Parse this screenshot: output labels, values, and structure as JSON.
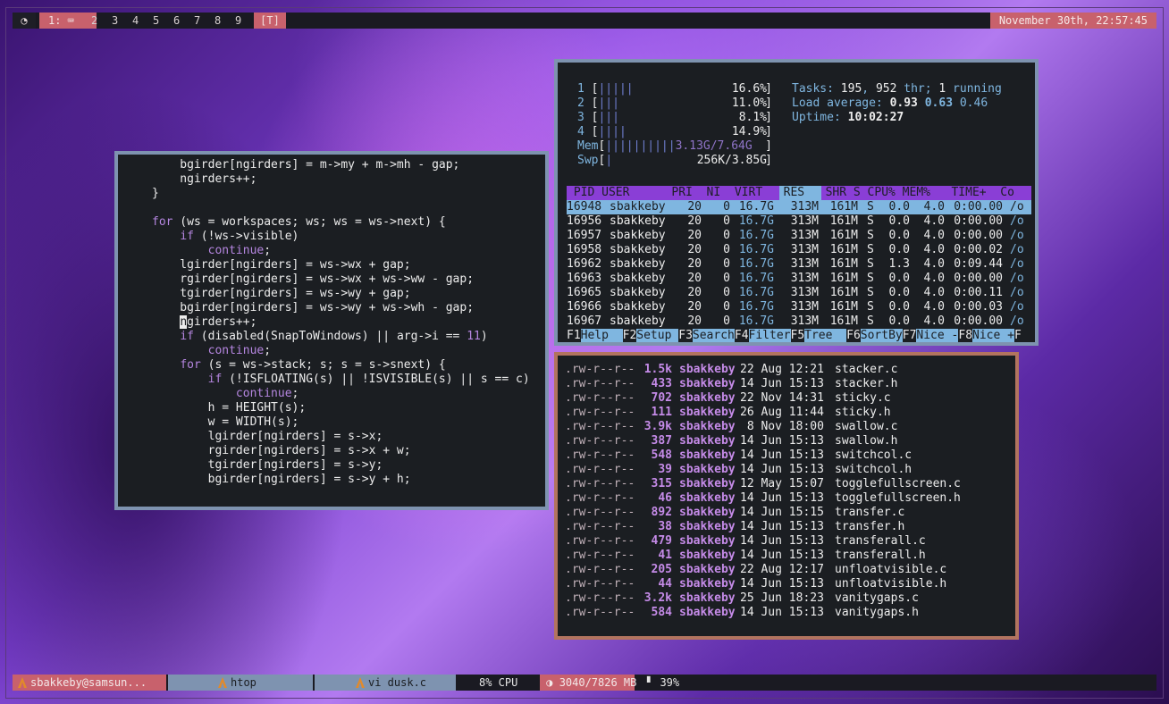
{
  "topbar": {
    "launcher_icon": "dusk-logo-icon",
    "active_workspace": "1: ⌨",
    "workspaces": [
      "2",
      "3",
      "4",
      "5",
      "6",
      "7",
      "8",
      "9"
    ],
    "tag_label": "[T]",
    "clock": "November 30th, 22:57:45"
  },
  "vi": {
    "lines": [
      "    bgirder[ngirders] = m->my + m->mh - gap;",
      "    ngirders++;",
      "}",
      "",
      "for (ws = workspaces; ws; ws = ws->next) {",
      "    if (!ws->visible)",
      "        continue;",
      "    lgirder[ngirders] = ws->wx + gap;",
      "    rgirder[ngirders] = ws->wx + ws->ww - gap;",
      "    tgirder[ngirders] = ws->wy + gap;",
      "    bgirder[ngirders] = ws->wy + ws->wh - gap;",
      "    ngirders++;",
      "    if (disabled(SnapToWindows) || arg->i == 11)",
      "        continue;",
      "    for (s = ws->stack; s; s = s->snext) {",
      "        if (!ISFLOATING(s) || !ISVISIBLE(s) || s == c)",
      "            continue;",
      "        h = HEIGHT(s);",
      "        w = WIDTH(s);",
      "        lgirder[ngirders] = s->x;",
      "        rgirder[ngirders] = s->x + w;",
      "        tgirder[ngirders] = s->y;",
      "        bgirder[ngirders] = s->y + h;"
    ]
  },
  "htop": {
    "cpus": [
      {
        "n": "1",
        "bars": "|||||",
        "pct": "16.6%"
      },
      {
        "n": "2",
        "bars": "|||",
        "pct": "11.0%"
      },
      {
        "n": "3",
        "bars": "|||",
        "pct": "8.1%"
      },
      {
        "n": "4",
        "bars": "||||",
        "pct": "14.9%"
      }
    ],
    "mem": {
      "label": "Mem",
      "bars": "||||||||||",
      "value": "3.13G/7.64G"
    },
    "swp": {
      "label": "Swp",
      "bars": "|",
      "value": "256K/3.85G"
    },
    "tasks_label": "Tasks:",
    "tasks": "195",
    "thr": "952",
    "thr_label": "thr;",
    "running": "1",
    "running_label": "running",
    "load_label": "Load average:",
    "load1": "0.93",
    "load5": "0.63",
    "load15": "0.46",
    "uptime_label": "Uptime:",
    "uptime": "10:02:27",
    "header": " PID USER      PRI  NI  VIRT   RES   SHR S CPU% MEM%   TIME+  Co",
    "processes": [
      {
        "pid": "16948",
        "user": "sbakkeby",
        "pri": "20",
        "ni": "0",
        "virt": "16.7G",
        "res": "313M",
        "shr": "161M",
        "s": "S",
        "cpu": "0.0",
        "mem": "4.0",
        "time": "0:00.00",
        "cmd": "/o"
      },
      {
        "pid": "16956",
        "user": "sbakkeby",
        "pri": "20",
        "ni": "0",
        "virt": "16.7G",
        "res": "313M",
        "shr": "161M",
        "s": "S",
        "cpu": "0.0",
        "mem": "4.0",
        "time": "0:00.00",
        "cmd": "/o"
      },
      {
        "pid": "16957",
        "user": "sbakkeby",
        "pri": "20",
        "ni": "0",
        "virt": "16.7G",
        "res": "313M",
        "shr": "161M",
        "s": "S",
        "cpu": "0.0",
        "mem": "4.0",
        "time": "0:00.00",
        "cmd": "/o"
      },
      {
        "pid": "16958",
        "user": "sbakkeby",
        "pri": "20",
        "ni": "0",
        "virt": "16.7G",
        "res": "313M",
        "shr": "161M",
        "s": "S",
        "cpu": "0.0",
        "mem": "4.0",
        "time": "0:00.02",
        "cmd": "/o"
      },
      {
        "pid": "16962",
        "user": "sbakkeby",
        "pri": "20",
        "ni": "0",
        "virt": "16.7G",
        "res": "313M",
        "shr": "161M",
        "s": "S",
        "cpu": "1.3",
        "mem": "4.0",
        "time": "0:09.44",
        "cmd": "/o"
      },
      {
        "pid": "16963",
        "user": "sbakkeby",
        "pri": "20",
        "ni": "0",
        "virt": "16.7G",
        "res": "313M",
        "shr": "161M",
        "s": "S",
        "cpu": "0.0",
        "mem": "4.0",
        "time": "0:00.00",
        "cmd": "/o"
      },
      {
        "pid": "16965",
        "user": "sbakkeby",
        "pri": "20",
        "ni": "0",
        "virt": "16.7G",
        "res": "313M",
        "shr": "161M",
        "s": "S",
        "cpu": "0.0",
        "mem": "4.0",
        "time": "0:00.11",
        "cmd": "/o"
      },
      {
        "pid": "16966",
        "user": "sbakkeby",
        "pri": "20",
        "ni": "0",
        "virt": "16.7G",
        "res": "313M",
        "shr": "161M",
        "s": "S",
        "cpu": "0.0",
        "mem": "4.0",
        "time": "0:00.03",
        "cmd": "/o"
      },
      {
        "pid": "16967",
        "user": "sbakkeby",
        "pri": "20",
        "ni": "0",
        "virt": "16.7G",
        "res": "313M",
        "shr": "161M",
        "s": "S",
        "cpu": "0.0",
        "mem": "4.0",
        "time": "0:00.00",
        "cmd": "/o"
      }
    ],
    "fkeys": [
      {
        "k": "F1",
        "l": "Help  "
      },
      {
        "k": "F2",
        "l": "Setup "
      },
      {
        "k": "F3",
        "l": "Search"
      },
      {
        "k": "F4",
        "l": "Filter"
      },
      {
        "k": "F5",
        "l": "Tree  "
      },
      {
        "k": "F6",
        "l": "SortBy"
      },
      {
        "k": "F7",
        "l": "Nice -"
      },
      {
        "k": "F8",
        "l": "Nice +"
      },
      {
        "k": "F",
        "l": ""
      }
    ]
  },
  "ls": {
    "files": [
      {
        "perm": ".rw-r--r--",
        "size": "1.5k",
        "user": "sbakkeby",
        "date": "22 Aug 12:21",
        "name": "stacker.c"
      },
      {
        "perm": ".rw-r--r--",
        "size": "433",
        "user": "sbakkeby",
        "date": "14 Jun 15:13",
        "name": "stacker.h"
      },
      {
        "perm": ".rw-r--r--",
        "size": "702",
        "user": "sbakkeby",
        "date": "22 Nov 14:31",
        "name": "sticky.c"
      },
      {
        "perm": ".rw-r--r--",
        "size": "111",
        "user": "sbakkeby",
        "date": "26 Aug 11:44",
        "name": "sticky.h"
      },
      {
        "perm": ".rw-r--r--",
        "size": "3.9k",
        "user": "sbakkeby",
        "date": " 8 Nov 18:00",
        "name": "swallow.c"
      },
      {
        "perm": ".rw-r--r--",
        "size": "387",
        "user": "sbakkeby",
        "date": "14 Jun 15:13",
        "name": "swallow.h"
      },
      {
        "perm": ".rw-r--r--",
        "size": "548",
        "user": "sbakkeby",
        "date": "14 Jun 15:13",
        "name": "switchcol.c"
      },
      {
        "perm": ".rw-r--r--",
        "size": "39",
        "user": "sbakkeby",
        "date": "14 Jun 15:13",
        "name": "switchcol.h"
      },
      {
        "perm": ".rw-r--r--",
        "size": "315",
        "user": "sbakkeby",
        "date": "12 May 15:07",
        "name": "togglefullscreen.c"
      },
      {
        "perm": ".rw-r--r--",
        "size": "46",
        "user": "sbakkeby",
        "date": "14 Jun 15:13",
        "name": "togglefullscreen.h"
      },
      {
        "perm": ".rw-r--r--",
        "size": "892",
        "user": "sbakkeby",
        "date": "14 Jun 15:15",
        "name": "transfer.c"
      },
      {
        "perm": ".rw-r--r--",
        "size": "38",
        "user": "sbakkeby",
        "date": "14 Jun 15:13",
        "name": "transfer.h"
      },
      {
        "perm": ".rw-r--r--",
        "size": "479",
        "user": "sbakkeby",
        "date": "14 Jun 15:13",
        "name": "transferall.c"
      },
      {
        "perm": ".rw-r--r--",
        "size": "41",
        "user": "sbakkeby",
        "date": "14 Jun 15:13",
        "name": "transferall.h"
      },
      {
        "perm": ".rw-r--r--",
        "size": "205",
        "user": "sbakkeby",
        "date": "22 Aug 12:17",
        "name": "unfloatvisible.c"
      },
      {
        "perm": ".rw-r--r--",
        "size": "44",
        "user": "sbakkeby",
        "date": "14 Jun 15:13",
        "name": "unfloatvisible.h"
      },
      {
        "perm": ".rw-r--r--",
        "size": "3.2k",
        "user": "sbakkeby",
        "date": "25 Jun 18:23",
        "name": "vanitygaps.c"
      },
      {
        "perm": ".rw-r--r--",
        "size": "584",
        "user": "sbakkeby",
        "date": "14 Jun 15:13",
        "name": "vanitygaps.h"
      }
    ]
  },
  "bottombar": {
    "task1": "sbakkeby@samsun...",
    "task2": "htop",
    "task3": "vi dusk.c",
    "cpu": "8% CPU",
    "mem": "3040/7826 MB",
    "battery": "39%"
  },
  "colors": {
    "accent": "#c8616c",
    "border": "#7e93b0",
    "ls_border": "#b2745f",
    "keyword": "#b586e0",
    "header": "#8a3ed6"
  }
}
